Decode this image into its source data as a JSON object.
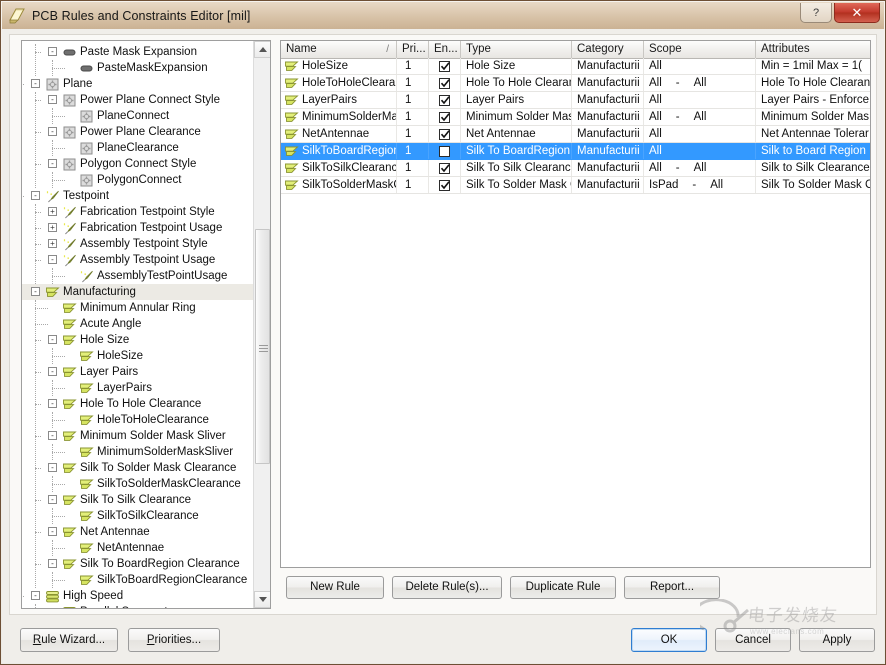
{
  "window": {
    "title": "PCB Rules and Constraints Editor [mil]",
    "icon": "pcb-rules-icon",
    "help_button": "?",
    "close_button": "✕"
  },
  "tree": {
    "nodes": [
      {
        "label": "Paste Mask Expansion",
        "depth": 2,
        "icon": "paste-mask-icon",
        "expander": "-",
        "selected": false
      },
      {
        "label": "PasteMaskExpansion",
        "depth": 3,
        "icon": "paste-mask-icon",
        "expander": "",
        "selected": false
      },
      {
        "label": "Plane",
        "depth": 1,
        "icon": "plane-icon",
        "expander": "-",
        "selected": false
      },
      {
        "label": "Power Plane Connect Style",
        "depth": 2,
        "icon": "plane-icon",
        "expander": "-",
        "selected": false
      },
      {
        "label": "PlaneConnect",
        "depth": 3,
        "icon": "plane-icon",
        "expander": "",
        "selected": false
      },
      {
        "label": "Power Plane Clearance",
        "depth": 2,
        "icon": "plane-icon",
        "expander": "-",
        "selected": false
      },
      {
        "label": "PlaneClearance",
        "depth": 3,
        "icon": "plane-icon",
        "expander": "",
        "selected": false
      },
      {
        "label": "Polygon Connect Style",
        "depth": 2,
        "icon": "plane-icon",
        "expander": "-",
        "selected": false
      },
      {
        "label": "PolygonConnect",
        "depth": 3,
        "icon": "plane-icon",
        "expander": "",
        "selected": false
      },
      {
        "label": "Testpoint",
        "depth": 1,
        "icon": "testpoint-icon",
        "expander": "-",
        "selected": false
      },
      {
        "label": "Fabrication Testpoint Style",
        "depth": 2,
        "icon": "testpoint-icon",
        "expander": "+",
        "selected": false
      },
      {
        "label": "Fabrication Testpoint Usage",
        "depth": 2,
        "icon": "testpoint-icon",
        "expander": "+",
        "selected": false
      },
      {
        "label": "Assembly Testpoint Style",
        "depth": 2,
        "icon": "testpoint-icon",
        "expander": "+",
        "selected": false
      },
      {
        "label": "Assembly Testpoint Usage",
        "depth": 2,
        "icon": "testpoint-icon",
        "expander": "-",
        "selected": false
      },
      {
        "label": "AssemblyTestPointUsage",
        "depth": 3,
        "icon": "testpoint-icon",
        "expander": "",
        "selected": false
      },
      {
        "label": "Manufacturing",
        "depth": 1,
        "icon": "manufacturing-icon",
        "expander": "-",
        "selected": true
      },
      {
        "label": "Minimum Annular Ring",
        "depth": 2,
        "icon": "manufacturing-icon",
        "expander": "",
        "selected": false
      },
      {
        "label": "Acute Angle",
        "depth": 2,
        "icon": "manufacturing-icon",
        "expander": "",
        "selected": false
      },
      {
        "label": "Hole Size",
        "depth": 2,
        "icon": "manufacturing-icon",
        "expander": "-",
        "selected": false
      },
      {
        "label": "HoleSize",
        "depth": 3,
        "icon": "manufacturing-icon",
        "expander": "",
        "selected": false
      },
      {
        "label": "Layer Pairs",
        "depth": 2,
        "icon": "manufacturing-icon",
        "expander": "-",
        "selected": false
      },
      {
        "label": "LayerPairs",
        "depth": 3,
        "icon": "manufacturing-icon",
        "expander": "",
        "selected": false
      },
      {
        "label": "Hole To Hole Clearance",
        "depth": 2,
        "icon": "manufacturing-icon",
        "expander": "-",
        "selected": false
      },
      {
        "label": "HoleToHoleClearance",
        "depth": 3,
        "icon": "manufacturing-icon",
        "expander": "",
        "selected": false
      },
      {
        "label": "Minimum Solder Mask Sliver",
        "depth": 2,
        "icon": "manufacturing-icon",
        "expander": "-",
        "selected": false
      },
      {
        "label": "MinimumSolderMaskSliver",
        "depth": 3,
        "icon": "manufacturing-icon",
        "expander": "",
        "selected": false
      },
      {
        "label": "Silk To Solder Mask Clearance",
        "depth": 2,
        "icon": "manufacturing-icon",
        "expander": "-",
        "selected": false
      },
      {
        "label": "SilkToSolderMaskClearance",
        "depth": 3,
        "icon": "manufacturing-icon",
        "expander": "",
        "selected": false
      },
      {
        "label": "Silk To Silk Clearance",
        "depth": 2,
        "icon": "manufacturing-icon",
        "expander": "-",
        "selected": false
      },
      {
        "label": "SilkToSilkClearance",
        "depth": 3,
        "icon": "manufacturing-icon",
        "expander": "",
        "selected": false
      },
      {
        "label": "Net Antennae",
        "depth": 2,
        "icon": "manufacturing-icon",
        "expander": "-",
        "selected": false
      },
      {
        "label": "NetAntennae",
        "depth": 3,
        "icon": "manufacturing-icon",
        "expander": "",
        "selected": false
      },
      {
        "label": "Silk To BoardRegion Clearance",
        "depth": 2,
        "icon": "manufacturing-icon",
        "expander": "-",
        "selected": false
      },
      {
        "label": "SilkToBoardRegionClearance",
        "depth": 3,
        "icon": "manufacturing-icon",
        "expander": "",
        "selected": false
      },
      {
        "label": "High Speed",
        "depth": 1,
        "icon": "high-speed-icon",
        "expander": "-",
        "selected": false
      },
      {
        "label": "Parallel Segment",
        "depth": 2,
        "icon": "high-speed-icon",
        "expander": "",
        "selected": false
      }
    ]
  },
  "grid": {
    "columns": [
      {
        "key": "name",
        "label": "Name",
        "sort": "/"
      },
      {
        "key": "priority",
        "label": "Pri...",
        "sort": ""
      },
      {
        "key": "enabled",
        "label": "En...",
        "sort": ""
      },
      {
        "key": "type",
        "label": "Type",
        "sort": ""
      },
      {
        "key": "category",
        "label": "Category",
        "sort": ""
      },
      {
        "key": "scope",
        "label": "Scope",
        "sort": ""
      },
      {
        "key": "attributes",
        "label": "Attributes",
        "sort": ""
      }
    ],
    "rows": [
      {
        "name": "HoleSize",
        "priority": "1",
        "enabled": true,
        "type": "Hole Size",
        "category": "Manufacturii",
        "scope_a": "All",
        "scope_sep": "",
        "scope_b": "",
        "attributes": "Min = 1mil    Max = 1(",
        "selected": false
      },
      {
        "name": "HoleToHoleClearar",
        "priority": "1",
        "enabled": true,
        "type": "Hole To Hole Clearanc",
        "category": "Manufacturii",
        "scope_a": "All",
        "scope_sep": "-",
        "scope_b": "All",
        "attributes": "Hole To Hole Clearan",
        "selected": false
      },
      {
        "name": "LayerPairs",
        "priority": "1",
        "enabled": true,
        "type": "Layer Pairs",
        "category": "Manufacturii",
        "scope_a": "All",
        "scope_sep": "",
        "scope_b": "",
        "attributes": "Layer Pairs - Enforce",
        "selected": false
      },
      {
        "name": "MinimumSolderMa",
        "priority": "1",
        "enabled": true,
        "type": "Minimum Solder Mask",
        "category": "Manufacturii",
        "scope_a": "All",
        "scope_sep": "-",
        "scope_b": "All",
        "attributes": "Minimum Solder Mas",
        "selected": false
      },
      {
        "name": "NetAntennae",
        "priority": "1",
        "enabled": true,
        "type": "Net Antennae",
        "category": "Manufacturii",
        "scope_a": "All",
        "scope_sep": "",
        "scope_b": "",
        "attributes": "Net Antennae Tolerar",
        "selected": false
      },
      {
        "name": "SilkToBoardRegion",
        "priority": "1",
        "enabled": false,
        "type": "Silk To BoardRegion C",
        "category": "Manufacturii",
        "scope_a": "All",
        "scope_sep": "",
        "scope_b": "",
        "attributes": "Silk to Board Region",
        "selected": true
      },
      {
        "name": "SilkToSilkClearance",
        "priority": "1",
        "enabled": true,
        "type": "Silk To Silk Clearance",
        "category": "Manufacturii",
        "scope_a": "All",
        "scope_sep": "-",
        "scope_b": "All",
        "attributes": "Silk to Silk Clearance",
        "selected": false
      },
      {
        "name": "SilkToSolderMaskC",
        "priority": "1",
        "enabled": true,
        "type": "Silk To Solder Mask Cl",
        "category": "Manufacturii",
        "scope_a": "IsPad",
        "scope_sep": "-",
        "scope_b": "All",
        "attributes": "Silk To Solder Mask C",
        "selected": false
      }
    ],
    "buttons": {
      "new_rule": "New Rule",
      "delete_rules": "Delete Rule(s)...",
      "duplicate_rule": "Duplicate Rule",
      "report": "Report..."
    }
  },
  "footer": {
    "rule_wizard": "Rule Wizard...",
    "priorities": "Priorities...",
    "ok": "OK",
    "cancel": "Cancel",
    "apply": "Apply"
  },
  "watermark": {
    "text": "电子发烧友",
    "sub": "www.elecfans.com"
  },
  "colors": {
    "selection": "#3399ff",
    "title_bar": "#d8c3a8",
    "close_button": "#c2392c",
    "manufacturing_icon": "#c9d84a",
    "window_border": "#6d4f35"
  }
}
